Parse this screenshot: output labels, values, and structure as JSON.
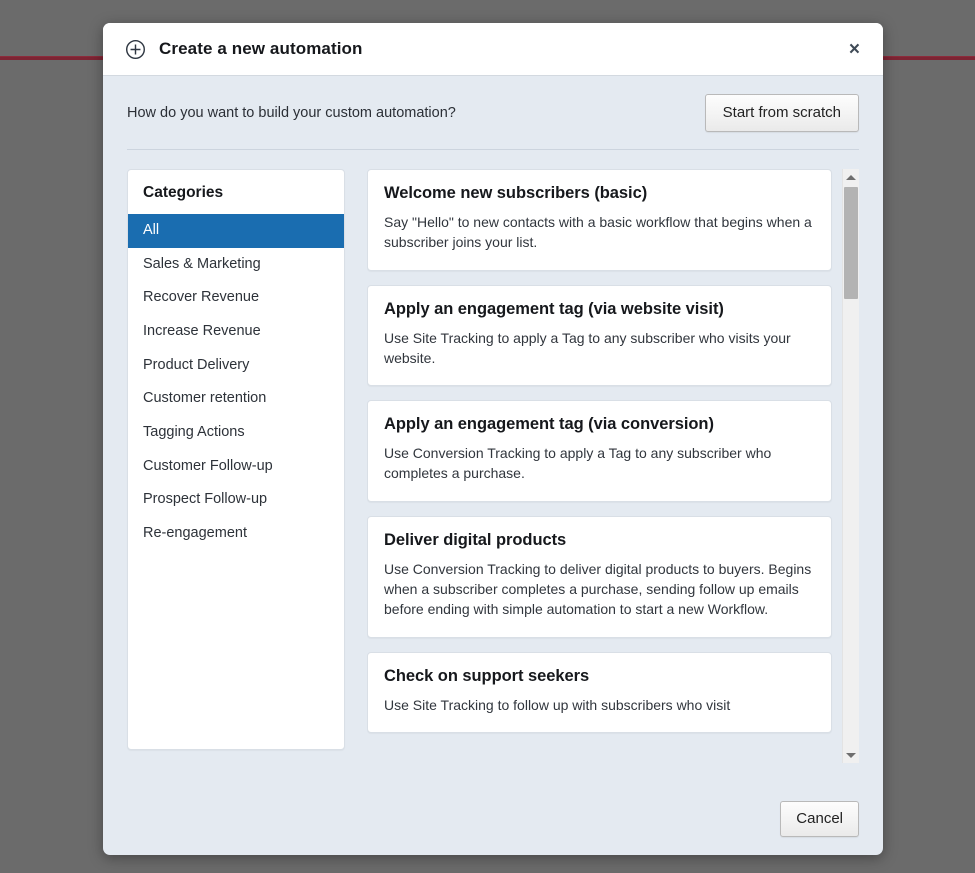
{
  "dialog": {
    "title": "Create a new automation",
    "title_icon": "plus-circle-icon",
    "close_label": "×"
  },
  "prompt": {
    "question": "How do you want to build your custom automation?",
    "start_scratch_label": "Start from scratch"
  },
  "categories": {
    "heading": "Categories",
    "selected": "All",
    "selected_color": "#1a6db0",
    "items": [
      {
        "label": "All"
      },
      {
        "label": "Sales & Marketing"
      },
      {
        "label": "Recover Revenue"
      },
      {
        "label": "Increase Revenue"
      },
      {
        "label": "Product Delivery"
      },
      {
        "label": "Customer retention"
      },
      {
        "label": "Tagging Actions"
      },
      {
        "label": "Customer Follow-up"
      },
      {
        "label": "Prospect Follow-up"
      },
      {
        "label": "Re-engagement"
      }
    ]
  },
  "templates": [
    {
      "title": "Welcome new subscribers (basic)",
      "description": "Say \"Hello\" to new contacts with a basic workflow that begins when a subscriber joins your list."
    },
    {
      "title": "Apply an engagement tag (via website visit)",
      "description": "Use Site Tracking to apply a Tag to any subscriber who visits your website."
    },
    {
      "title": "Apply an engagement tag (via conversion)",
      "description": "Use Conversion Tracking to apply a Tag to any subscriber who completes a purchase."
    },
    {
      "title": "Deliver digital products",
      "description": "Use Conversion Tracking to deliver digital products to buyers. Begins when a subscriber completes a purchase, sending follow up emails before ending with simple automation to start a new Workflow."
    },
    {
      "title": "Check on support seekers",
      "description": "Use Site Tracking to follow up with subscribers who visit"
    }
  ],
  "scrollbar": {
    "up_arrow": "scroll-up-arrow-icon",
    "down_arrow": "scroll-down-arrow-icon"
  },
  "footer": {
    "cancel_label": "Cancel"
  }
}
